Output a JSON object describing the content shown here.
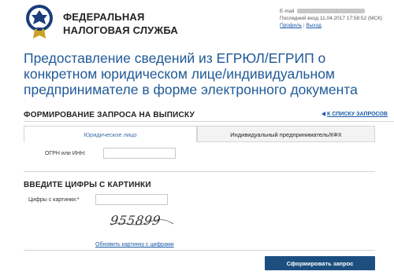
{
  "header": {
    "brand_line1": "ФЕДЕРАЛЬНАЯ",
    "brand_line2": "НАЛОГОВАЯ СЛУЖБА",
    "email_label": "E-mail",
    "last_login_label": "Последний вход",
    "last_login_value": "11.04.2017 17:58:52 (МСК)",
    "profile_link": "Профиль",
    "link_separator": "|",
    "logout_link": "Выход"
  },
  "page": {
    "title": "Предоставление сведений из ЕГРЮЛ/ЕГРИП о конкретном юридическом лице/индивидуальном предпринимателе в форме электронного документа"
  },
  "form": {
    "section_title": "ФОРМИРОВАНИЕ ЗАПРОСА НА ВЫПИСКУ",
    "back_link": "К СПИСКУ ЗАПРОСОВ",
    "tabs": [
      {
        "label": "Юридическое лицо",
        "active": true
      },
      {
        "label": "Индивидуальный предприниматель/КФХ",
        "active": false
      }
    ],
    "ogrn_label": "ОГРН или ИНН:",
    "ogrn_value": ""
  },
  "captcha": {
    "section_title": "ВВЕДИТЕ ЦИФРЫ С КАРТИНКИ",
    "input_label": "Цифры с картинки:",
    "required_mark": "*",
    "input_value": "",
    "image_text": "955899",
    "refresh_link": "Обновить картинку с цифрами"
  },
  "actions": {
    "submit_label": "Сформировать запрос"
  },
  "colors": {
    "title": "#1f5a97",
    "link": "#1a5aa6",
    "button": "#1c4f80"
  }
}
